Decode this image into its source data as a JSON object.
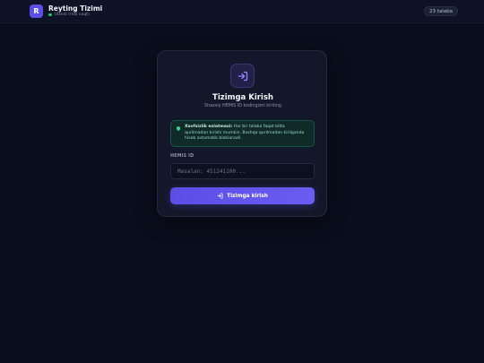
{
  "header": {
    "logo_letter": "R",
    "title": "Reyting Tizimi",
    "status": "Ulandi (real vaqt)",
    "student_count": "23 talaba"
  },
  "login": {
    "title": "Tizimga Kirish",
    "subtitle": "Shaxsiy HEMIS ID kodingizni kiriting",
    "notice_strong": "Xavfsizlik eslatmasi:",
    "notice_text": "Har bir talaba faqat bitta qurilmadan kirishi mumkin. Boshqa qurilmadan kirilganda hisob avtomatik bloklanadi.",
    "field_label": "HEMIS ID",
    "input_value": "",
    "input_placeholder": "Masalan: 451241100...",
    "submit_label": "Tizimga kirish"
  },
  "colors": {
    "accent": "#5b4ee6",
    "background": "#0a0e1c",
    "card": "#121829",
    "notice_bg": "#0f2a27",
    "online": "#22c55e"
  },
  "icons": {
    "login": "login-icon",
    "shield": "shield-icon"
  }
}
